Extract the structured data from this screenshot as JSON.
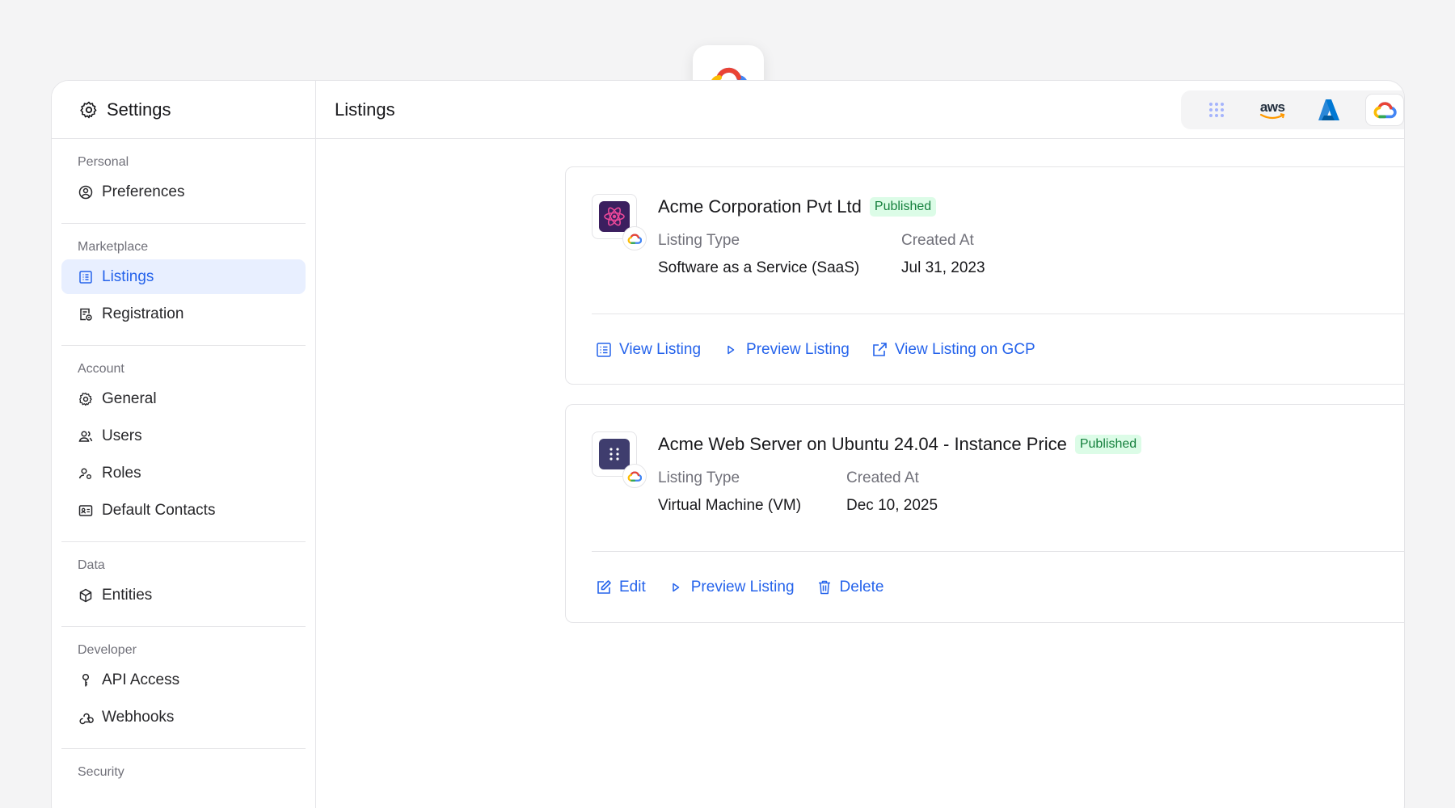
{
  "sidebar": {
    "title": "Settings",
    "groups": [
      {
        "label": "Personal",
        "items": [
          {
            "label": "Preferences",
            "icon": "user-circle-icon"
          }
        ]
      },
      {
        "label": "Marketplace",
        "items": [
          {
            "label": "Listings",
            "icon": "list-icon",
            "active": true
          },
          {
            "label": "Registration",
            "icon": "registration-icon"
          }
        ]
      },
      {
        "label": "Account",
        "items": [
          {
            "label": "General",
            "icon": "gear-icon"
          },
          {
            "label": "Users",
            "icon": "users-icon"
          },
          {
            "label": "Roles",
            "icon": "roles-icon"
          },
          {
            "label": "Default Contacts",
            "icon": "contact-card-icon"
          }
        ]
      },
      {
        "label": "Data",
        "items": [
          {
            "label": "Entities",
            "icon": "cube-icon"
          }
        ]
      },
      {
        "label": "Developer",
        "items": [
          {
            "label": "API Access",
            "icon": "key-icon"
          },
          {
            "label": "Webhooks",
            "icon": "webhook-icon"
          }
        ]
      },
      {
        "label": "Security",
        "items": []
      }
    ]
  },
  "header": {
    "title": "Listings"
  },
  "cloud_switcher": {
    "items": [
      "all-clouds-icon",
      "aws-logo",
      "azure-logo",
      "google-cloud-logo"
    ],
    "aws_text": "aws",
    "active": "google-cloud-logo"
  },
  "listings": [
    {
      "title": "Acme Corporation Pvt Ltd",
      "status": "Published",
      "listing_type_label": "Listing Type",
      "listing_type": "Software as a Service (SaaS)",
      "created_label": "Created At",
      "created_at": "Jul 31, 2023",
      "actions": [
        "View Listing",
        "Preview Listing",
        "View Listing on GCP"
      ]
    },
    {
      "title": "Acme Web Server on Ubuntu 24.04 - Instance Price",
      "status": "Published",
      "listing_type_label": "Listing Type",
      "listing_type": "Virtual Machine (VM)",
      "created_label": "Created At",
      "created_at": "Dec 10, 2025",
      "actions": [
        "Edit",
        "Preview Listing",
        "Delete"
      ]
    }
  ],
  "colors": {
    "accent": "#2563eb",
    "active_bg": "#e8efff",
    "badge_text": "#15803d",
    "badge_bg": "#dcfce7"
  }
}
